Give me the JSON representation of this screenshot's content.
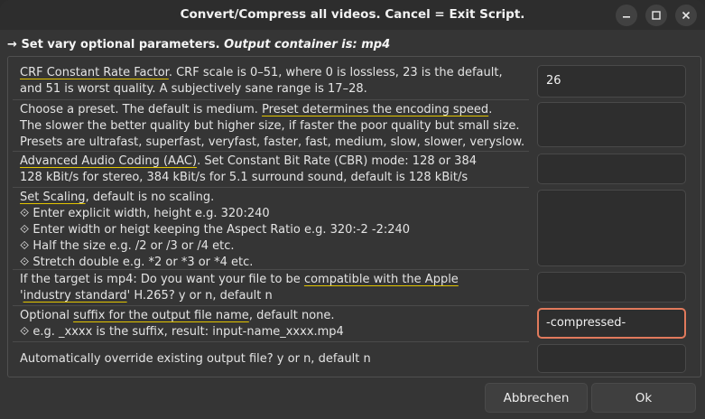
{
  "window": {
    "title": "Convert/Compress all videos. Cancel = Exit Script.",
    "controls": [
      "minimize-icon",
      "maximize-icon",
      "close-icon"
    ]
  },
  "section": {
    "arrow": "→",
    "label": "Set vary optional parameters.",
    "container_text": "Output container is: mp4"
  },
  "params": [
    {
      "lines": [
        [
          "CRF Constant Rate Factor",
          ". CRF scale is 0–51, where 0 is lossless, 23 is the default,"
        ],
        [
          "and 51 is worst quality. A subjectively sane range is 17–28."
        ]
      ],
      "value": "26"
    },
    {
      "lines": [
        [
          "Choose a preset. The default is medium. ",
          "Preset determines the encoding speed",
          "."
        ],
        [
          "The slower the better quality but higher size, if faster the poor quality but small size."
        ],
        [
          "Presets are ultrafast, superfast, veryfast, faster, fast, medium, slow, slower, veryslow."
        ]
      ],
      "value": ""
    },
    {
      "lines": [
        [
          "Advanced Audio Coding (AAC)",
          ". Set Constant Bit Rate (CBR) mode: 128 or 384"
        ],
        [
          "128 kBit/s for stereo, 384 kBit/s for 5.1 surround sound, default is 128 kBit/s"
        ]
      ],
      "value": ""
    },
    {
      "lines": [
        [
          "Set Scaling",
          ", default is no scaling."
        ],
        [
          "⟐ Enter explicit width, height e.g. 320:240"
        ],
        [
          "⟐ Enter width or heigt keeping the Aspect Ratio e.g. 320:-2  -2:240"
        ],
        [
          "⟐ Half the size e.g. /2 or /3 or /4 etc."
        ],
        [
          "⟐ Stretch double e.g. *2 or *3 or *4 etc."
        ]
      ],
      "value": ""
    },
    {
      "lines": [
        [
          "If the target is mp4: Do you want your file to be ",
          "compatible with the Apple"
        ],
        [
          "'",
          "industry standard",
          "' H.265? y or n, default n"
        ]
      ],
      "value": ""
    },
    {
      "lines": [
        [
          "Optional ",
          "suffix for the output file name",
          ", default none."
        ],
        [
          "⟐ e.g. _xxxx is the suffix, result: input-name_xxxx.mp4"
        ]
      ],
      "value": "-compressed-"
    },
    {
      "lines": [
        [
          "Automatically override existing output file? y or n, default n"
        ]
      ],
      "value": ""
    }
  ],
  "buttons": {
    "cancel": "Abbrechen",
    "ok": "Ok"
  },
  "colors": {
    "underline_accent": "#e2c400",
    "focus_border": "#e17a5c",
    "window_bg": "#353535"
  }
}
